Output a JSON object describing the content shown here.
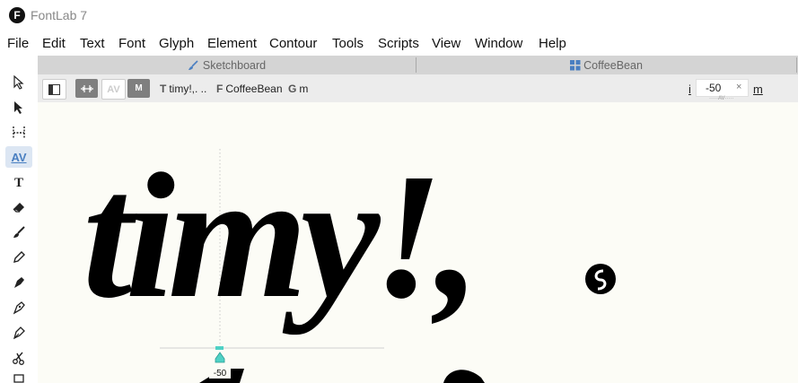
{
  "app": {
    "title": "FontLab 7",
    "logo_letter": "F"
  },
  "menu": [
    "File",
    "Edit",
    "Text",
    "Font",
    "Glyph",
    "Element",
    "Contour",
    "Tools",
    "Scripts",
    "View",
    "Window",
    "Help"
  ],
  "tabs": [
    {
      "label": "Sketchboard",
      "icon": "brush-icon"
    },
    {
      "label": "CoffeeBean",
      "icon": "grid-icon"
    }
  ],
  "subtoolbar": {
    "text_field": {
      "prefix": "T",
      "value": "timy!,. .."
    },
    "font_field": {
      "prefix": "F",
      "value": "CoffeeBean"
    },
    "glyph_field": {
      "prefix": "G",
      "value": "m"
    },
    "m_button_label": "M",
    "av_button_label": "AV",
    "kern_left": "i",
    "kern_value": "-50",
    "kern_clear": "×",
    "kern_right": "m",
    "kern_caption": "·····AV·····"
  },
  "canvas": {
    "sample_text": "timy!,",
    "kern_marker_label": "-50"
  },
  "colors": {
    "accent": "#4a7fc1",
    "teal": "#4fd1c5",
    "canvas": "#fcfcf6",
    "tabs": "#d4d4d4"
  }
}
